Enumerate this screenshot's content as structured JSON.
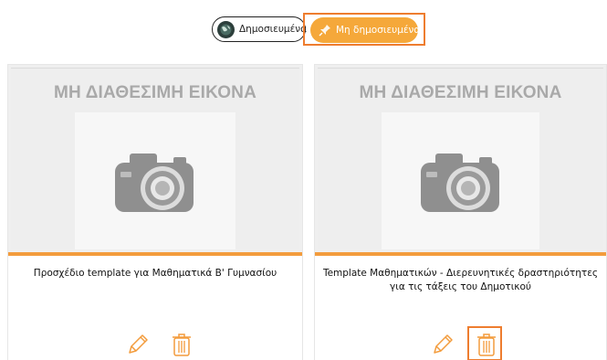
{
  "filter": {
    "published_label": "Δημοσιευμένα",
    "unpublished_label": "Μη δημοσιευμένα",
    "active": "unpublished"
  },
  "colors": {
    "accent": "#f5a83a",
    "highlight_border": "#ee7d2f",
    "divider": "#f39c3d"
  },
  "cards": [
    {
      "image_placeholder": "ΜΗ ΔΙΑΘΕΣΙΜΗ ΕΙΚΟΝΑ",
      "title": "Προσχέδιο template για Μαθηματικά Β' Γυμνασίου",
      "actions": [
        "pencil-icon",
        "trash-icon"
      ]
    },
    {
      "image_placeholder": "ΜΗ ΔΙΑΘΕΣΙΜΗ ΕΙΚΟΝΑ",
      "title": "Template Μαθηματικών - Διερευνητικές δραστηριότητες για τις τάξεις του Δημοτικού",
      "actions": [
        "pencil-icon",
        "trash-icon"
      ]
    }
  ]
}
